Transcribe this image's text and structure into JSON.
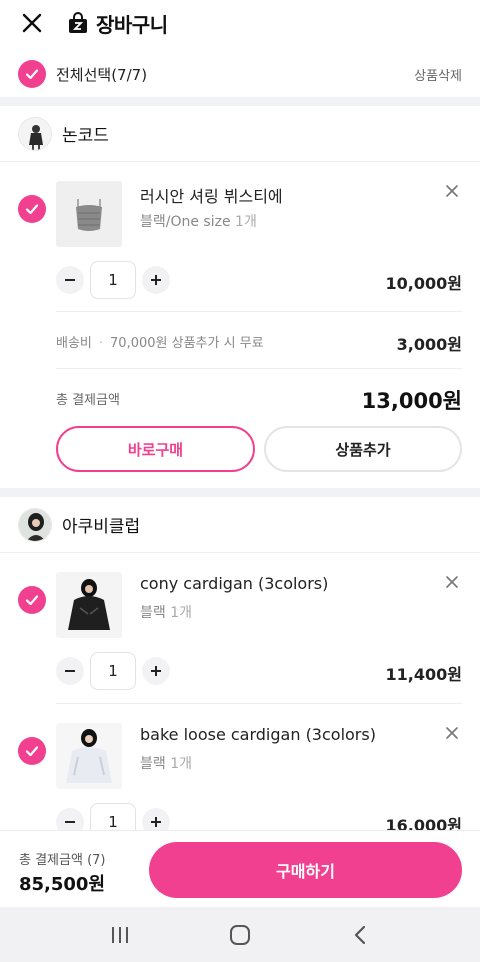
{
  "header": {
    "title": "장바구니"
  },
  "select_all": {
    "label": "전체선택(7/7)",
    "delete_label": "상품삭제"
  },
  "stores": [
    {
      "name": "논코드",
      "items": [
        {
          "name": "러시안 셔링 뷔스티에",
          "option": "블랙/One size",
          "qty_text": "1개",
          "quantity": "1",
          "price": "10,000원"
        }
      ],
      "shipping_label": "배송비",
      "shipping_note": "70,000원 상품추가 시 무료",
      "shipping_fee": "3,000원",
      "total_label": "총 결제금액",
      "total_value": "13,000원",
      "buy_now_label": "바로구매",
      "add_label": "상품추가"
    },
    {
      "name": "아쿠비클럽",
      "items": [
        {
          "name": "cony cardigan (3colors)",
          "option": "블랙",
          "qty_text": "1개",
          "quantity": "1",
          "price": "11,400원"
        },
        {
          "name": "bake loose cardigan (3colors)",
          "option": "블랙",
          "qty_text": "1개",
          "quantity": "1",
          "price": "16,000원"
        }
      ]
    }
  ],
  "footer": {
    "total_label": "총 결제금액 (7)",
    "total_value": "85,500원",
    "purchase_label": "구매하기"
  },
  "colors": {
    "accent": "#f0408f",
    "divider_band": "#f1f2f5"
  }
}
